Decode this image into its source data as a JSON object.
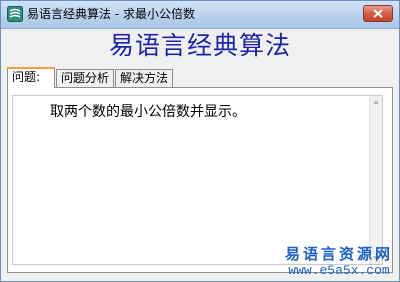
{
  "window": {
    "title": "易语言经典算法 - 求最小公倍数"
  },
  "banner": {
    "title": "易语言经典算法"
  },
  "tabs": [
    {
      "label": "问题:"
    },
    {
      "label": "问题分析"
    },
    {
      "label": "解决方法"
    }
  ],
  "content": {
    "text": "取两个数的最小公倍数并显示。"
  },
  "watermark": {
    "name": "易语言资源网",
    "url": "www.e5a5x.com"
  },
  "colors": {
    "banner_text": "#1c25a8",
    "watermark": "#1e5fc8",
    "active_tab_accent": "#f5a03c",
    "close_button": "#c2432a"
  }
}
